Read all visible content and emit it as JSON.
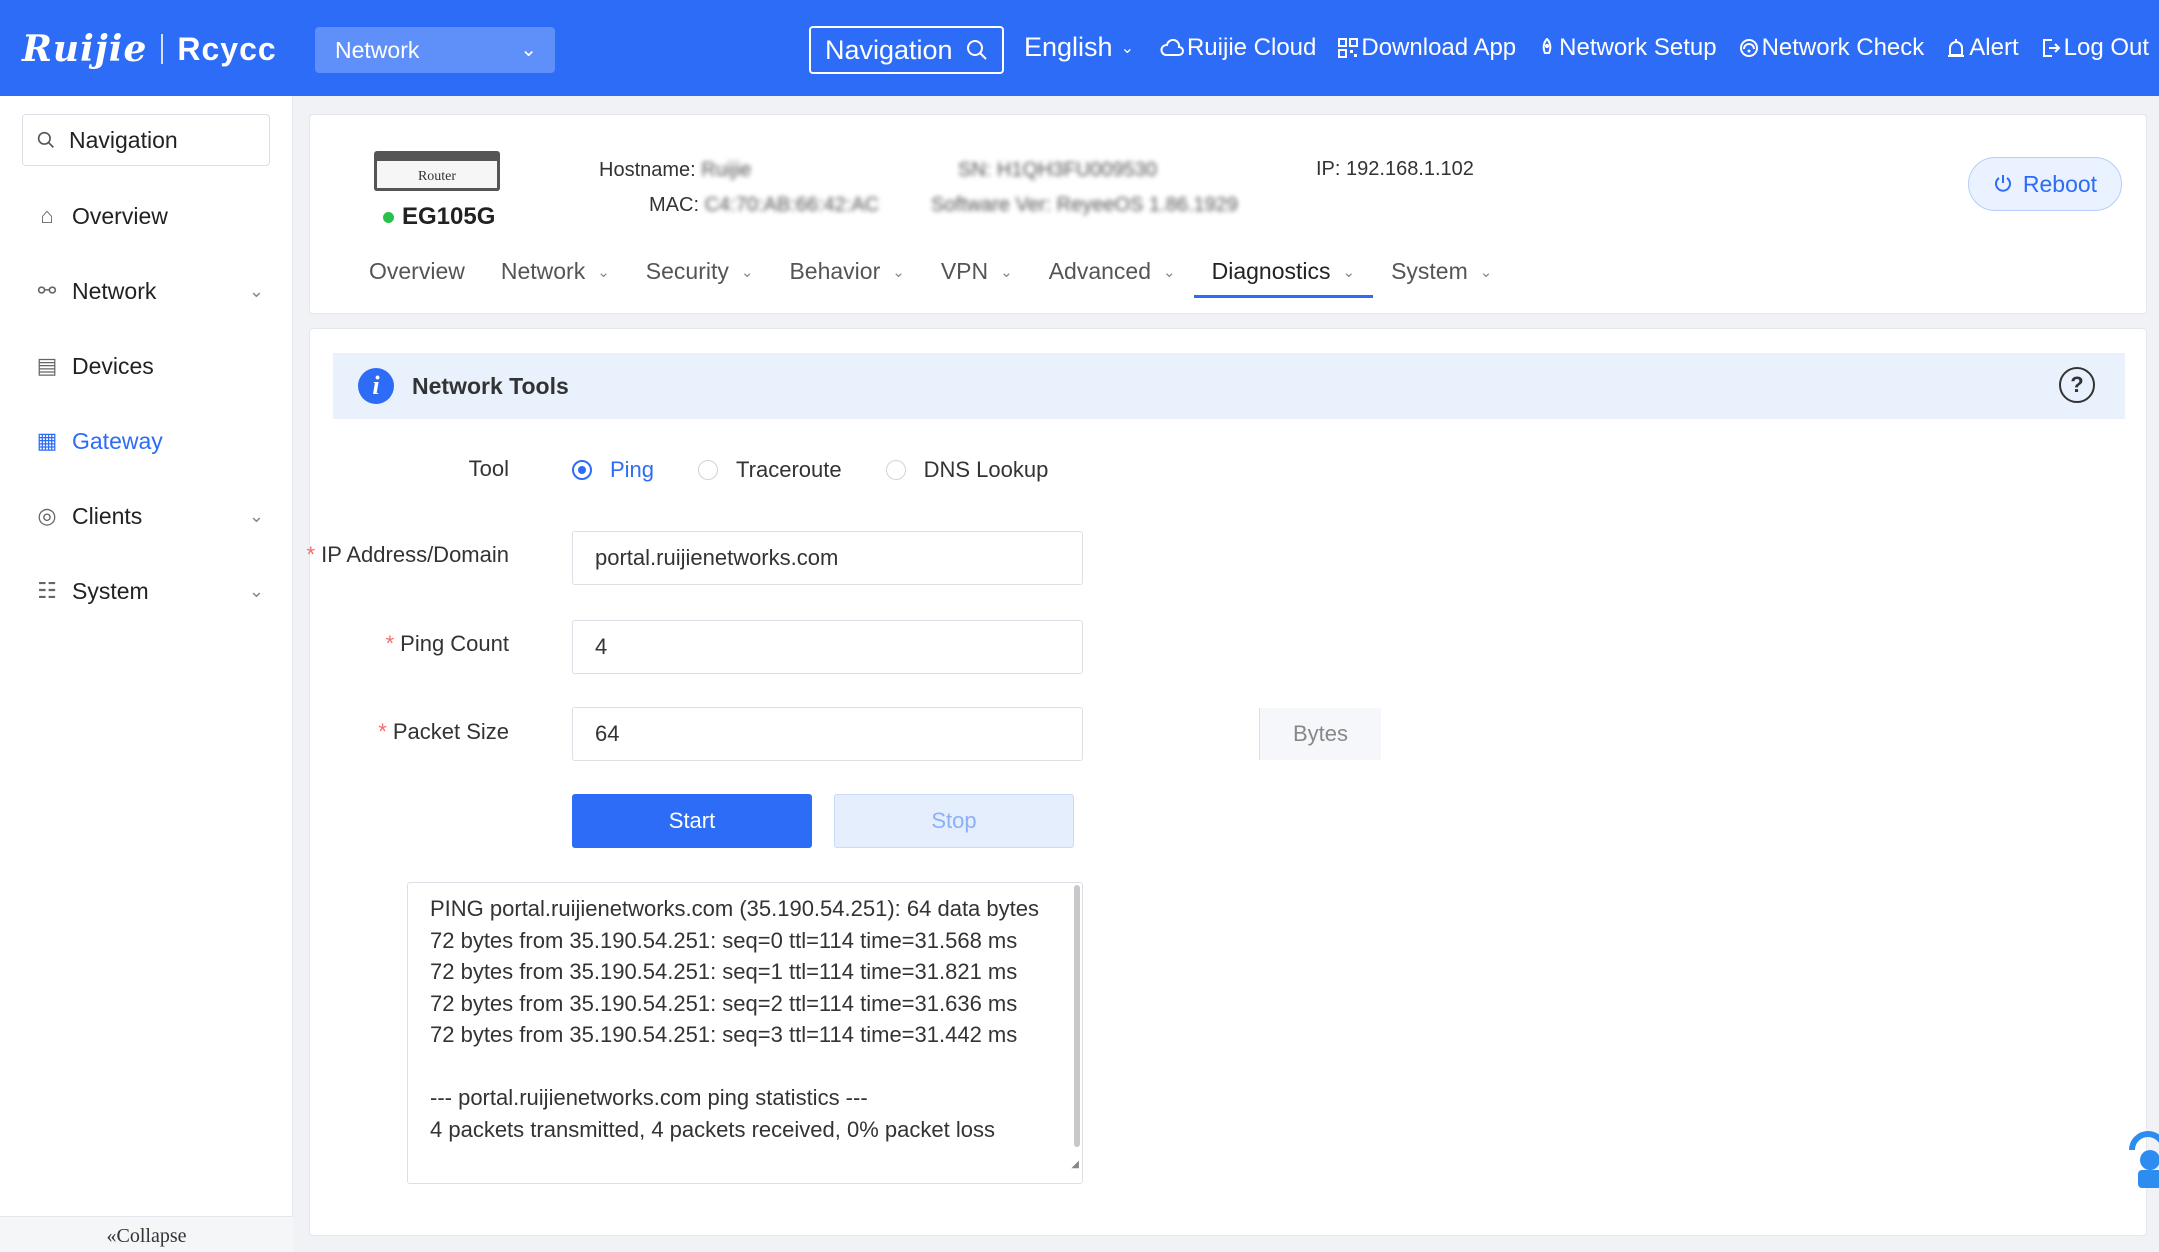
{
  "brand": {
    "primary": "Ruijie",
    "secondary": "Rcycc"
  },
  "topbar": {
    "network_select": "Network",
    "navigation_button": "Navigation",
    "language": "English",
    "links": {
      "cloud": "Ruijie Cloud",
      "download": "Download App",
      "setup": "Network Setup",
      "check": "Network Check",
      "alert": "Alert",
      "logout": "Log Out"
    }
  },
  "sidebar": {
    "search_placeholder": "Navigation",
    "items": [
      {
        "label": "Overview",
        "icon": "home-icon"
      },
      {
        "label": "Network",
        "icon": "topology-icon"
      },
      {
        "label": "Devices",
        "icon": "devices-icon"
      },
      {
        "label": "Gateway",
        "icon": "gateway-icon"
      },
      {
        "label": "Clients",
        "icon": "user-icon"
      },
      {
        "label": "System",
        "icon": "settings-sliders-icon"
      }
    ],
    "collapse": "Collapse"
  },
  "device": {
    "image_label": "Router",
    "model": "EG105G",
    "hostname_label": "Hostname:",
    "hostname": "Ruijie",
    "mac_label": "MAC:",
    "mac": "C4:70:AB:66:42:AC",
    "sn_label": "SN:",
    "sn": "H1QH3FU009530",
    "sw_label": "Software Ver:",
    "sw": "ReyeeOS 1.86.1929",
    "ip_label": "IP:",
    "ip": "192.168.1.102",
    "reboot": "Reboot",
    "status_color": "#2bbf4c"
  },
  "tabs": [
    "Overview",
    "Network",
    "Security",
    "Behavior",
    "VPN",
    "Advanced",
    "Diagnostics",
    "System"
  ],
  "tool": {
    "title": "Network Tools",
    "tool_label": "Tool",
    "options": [
      "Ping",
      "Traceroute",
      "DNS Lookup"
    ],
    "selected": "Ping",
    "ip_label": "IP Address/Domain",
    "ip_value": "portal.ruijienetworks.com",
    "count_label": "Ping Count",
    "count_value": "4",
    "size_label": "Packet Size",
    "size_value": "64",
    "size_unit": "Bytes",
    "start": "Start",
    "stop": "Stop",
    "output": {
      "line1": "PING portal.ruijienetworks.com (35.190.54.251): 64 data bytes",
      "line2": "72 bytes from 35.190.54.251: seq=0 ttl=114 time=31.568 ms",
      "line3": "72 bytes from 35.190.54.251: seq=1 ttl=114 time=31.821 ms",
      "line4": "72 bytes from 35.190.54.251: seq=2 ttl=114 time=31.636 ms",
      "line5": "72 bytes from 35.190.54.251: seq=3 ttl=114 time=31.442 ms",
      "line6": "--- portal.ruijienetworks.com ping statistics ---",
      "line7": "4 packets transmitted, 4 packets received, 0% packet loss"
    }
  },
  "colors": {
    "accent": "#2d6cf6",
    "required": "#f56c6c"
  }
}
